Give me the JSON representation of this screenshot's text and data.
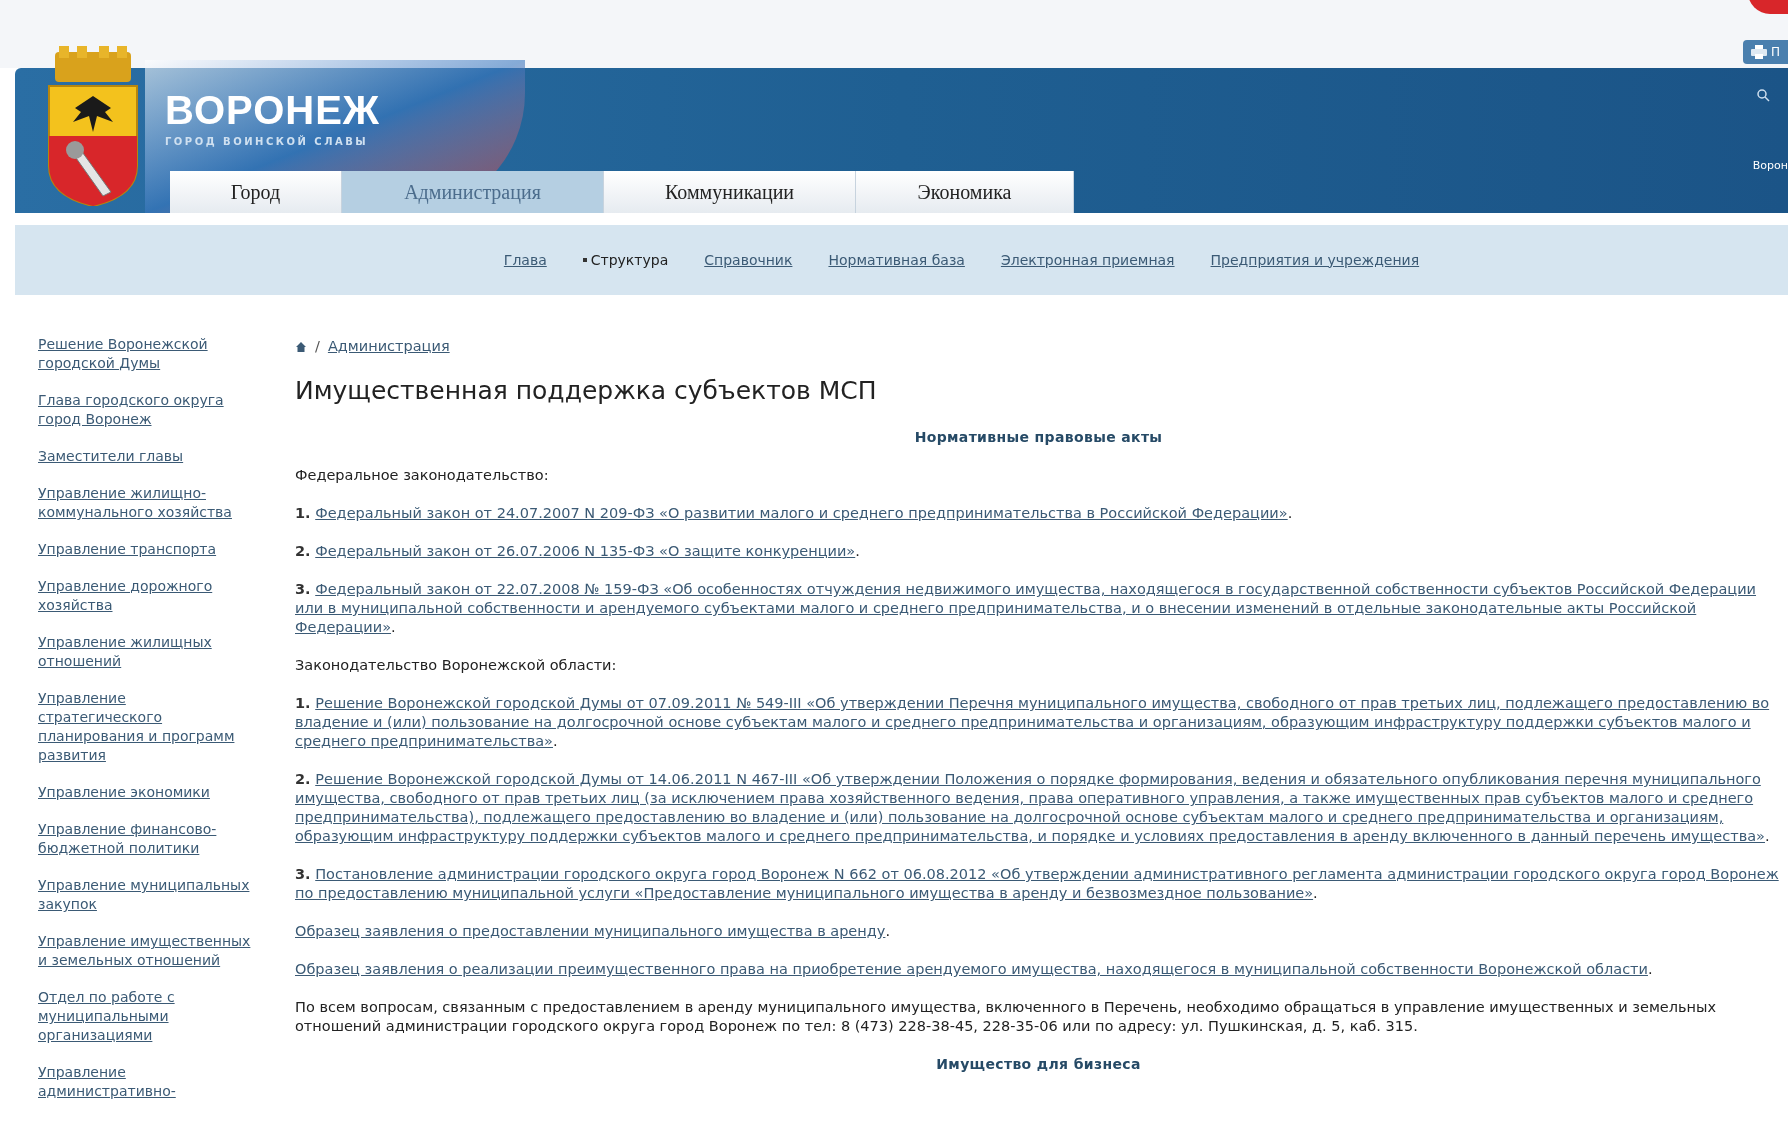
{
  "header": {
    "city": "ВОРОНЕЖ",
    "motto": "ГОРОД ВОИНСКОЙ СЛАВЫ",
    "print_button": "П",
    "region_label": "Ворон"
  },
  "main_tabs": [
    {
      "label": "Город",
      "selected": false
    },
    {
      "label": "Администрация",
      "selected": true
    },
    {
      "label": "Коммуникации",
      "selected": false
    },
    {
      "label": "Экономика",
      "selected": false
    }
  ],
  "sub_nav": [
    {
      "label": "Глава",
      "selected": false
    },
    {
      "label": "Структура",
      "selected": true
    },
    {
      "label": "Справочник",
      "selected": false
    },
    {
      "label": "Нормативная база",
      "selected": false
    },
    {
      "label": "Электронная приемная",
      "selected": false
    },
    {
      "label": "Предприятия и учреждения",
      "selected": false
    }
  ],
  "sidebar": {
    "items": [
      "Решение Воронежской городской Думы",
      "Глава городского округа город Воронеж",
      "Заместители главы",
      "Управление жилищно-коммунального хозяйства",
      "Управление транспорта",
      "Управление дорожного хозяйства",
      "Управление жилищных отношений",
      "Управление стратегического планирования и программ развития",
      "Управление экономики",
      "Управление финансово-бюджетной политики",
      "Управление муниципальных закупок",
      "Управление имущественных и земельных отношений",
      "Отдел по работе с муниципальными организациями",
      "Управление административно-"
    ]
  },
  "breadcrumb": {
    "separator": "/",
    "items": [
      "Администрация"
    ]
  },
  "title": "Имущественная поддержка субъектов МСП",
  "content": [
    {
      "kind": "heading",
      "text": "Нормативные правовые акты"
    },
    {
      "kind": "label",
      "text": "Федеральное законодательство:"
    },
    {
      "kind": "item",
      "number": "1.",
      "link": "Федеральный закон от 24.07.2007 N 209-ФЗ «О развитии малого и среднего предпринимательства в Российской Федерации»",
      "tail": "."
    },
    {
      "kind": "item",
      "number": "2.",
      "link": "Федеральный закон от 26.07.2006 N 135-ФЗ «О защите конкуренции»",
      "tail": "."
    },
    {
      "kind": "item",
      "number": "3.",
      "link": "Федеральный закон от 22.07.2008 № 159-ФЗ «Об особенностях отчуждения недвижимого имущества, находящегося в государственной собственности субъектов Российской Федерации или в муниципальной собственности и арендуемого субъектами малого и среднего предпринимательства, и о внесении изменений в отдельные законодательные акты Российской Федерации»",
      "tail": "."
    },
    {
      "kind": "label",
      "text": "Законодательство Воронежской области:"
    },
    {
      "kind": "item",
      "number": "1.",
      "link": "Решение Воронежской городской Думы от 07.09.2011 № 549-III «Об утверждении Перечня муниципального имущества, свободного от прав третьих лиц, подлежащего предоставлению во владение и (или) пользование на долгосрочной основе субъектам малого и среднего предпринимательства и организациям, образующим инфраструктуру поддержки субъектов малого и среднего предпринимательства»",
      "tail": "."
    },
    {
      "kind": "item",
      "number": "2.",
      "link": "Решение Воронежской городской Думы от 14.06.2011 N 467-III «Об утверждении Положения о порядке формирования, ведения и обязательного опубликования перечня муниципального имущества, свободного от прав третьих лиц (за исключением права хозяйственного ведения, права оперативного управления, а также имущественных прав субъектов малого и среднего предпринимательства), подлежащего предоставлению во владение и (или) пользование на долгосрочной основе субъектам малого и среднего предпринимательства и организациям, образующим инфраструктуру поддержки субъектов малого и среднего предпринимательства, и порядке и условиях предоставления в аренду включенного в данный перечень имущества»",
      "tail": "."
    },
    {
      "kind": "item",
      "number": "3.",
      "link": "Постановление администрации городского округа город Воронеж N 662 от 06.08.2012 «Об утверждении административного регламента администрации городского округа город Воронеж по предоставлению муниципальной услуги «Предоставление муниципального имущества в аренду и безвозмездное пользование»",
      "tail": "."
    },
    {
      "kind": "link",
      "link": "Образец заявления о предоставлении муниципального имущества в аренду",
      "tail": "."
    },
    {
      "kind": "link",
      "link": "Образец заявления о реализации преимущественного права на приобретение арендуемого имущества, находящегося в муниципальной собственности Воронежской области",
      "tail": "."
    },
    {
      "kind": "text",
      "text": "По всем вопросам, связанным с предоставлением в аренду муниципального имущества, включенного в Перечень, необходимо обращаться в управление имущественных и земельных отношений администрации городского округа город Воронеж по тел: 8 (473) 228-38-45, 228-35-06 или по адресу: ул. Пушкинская, д. 5, каб. 315."
    },
    {
      "kind": "heading",
      "text": "Имущество для бизнеса"
    }
  ]
}
